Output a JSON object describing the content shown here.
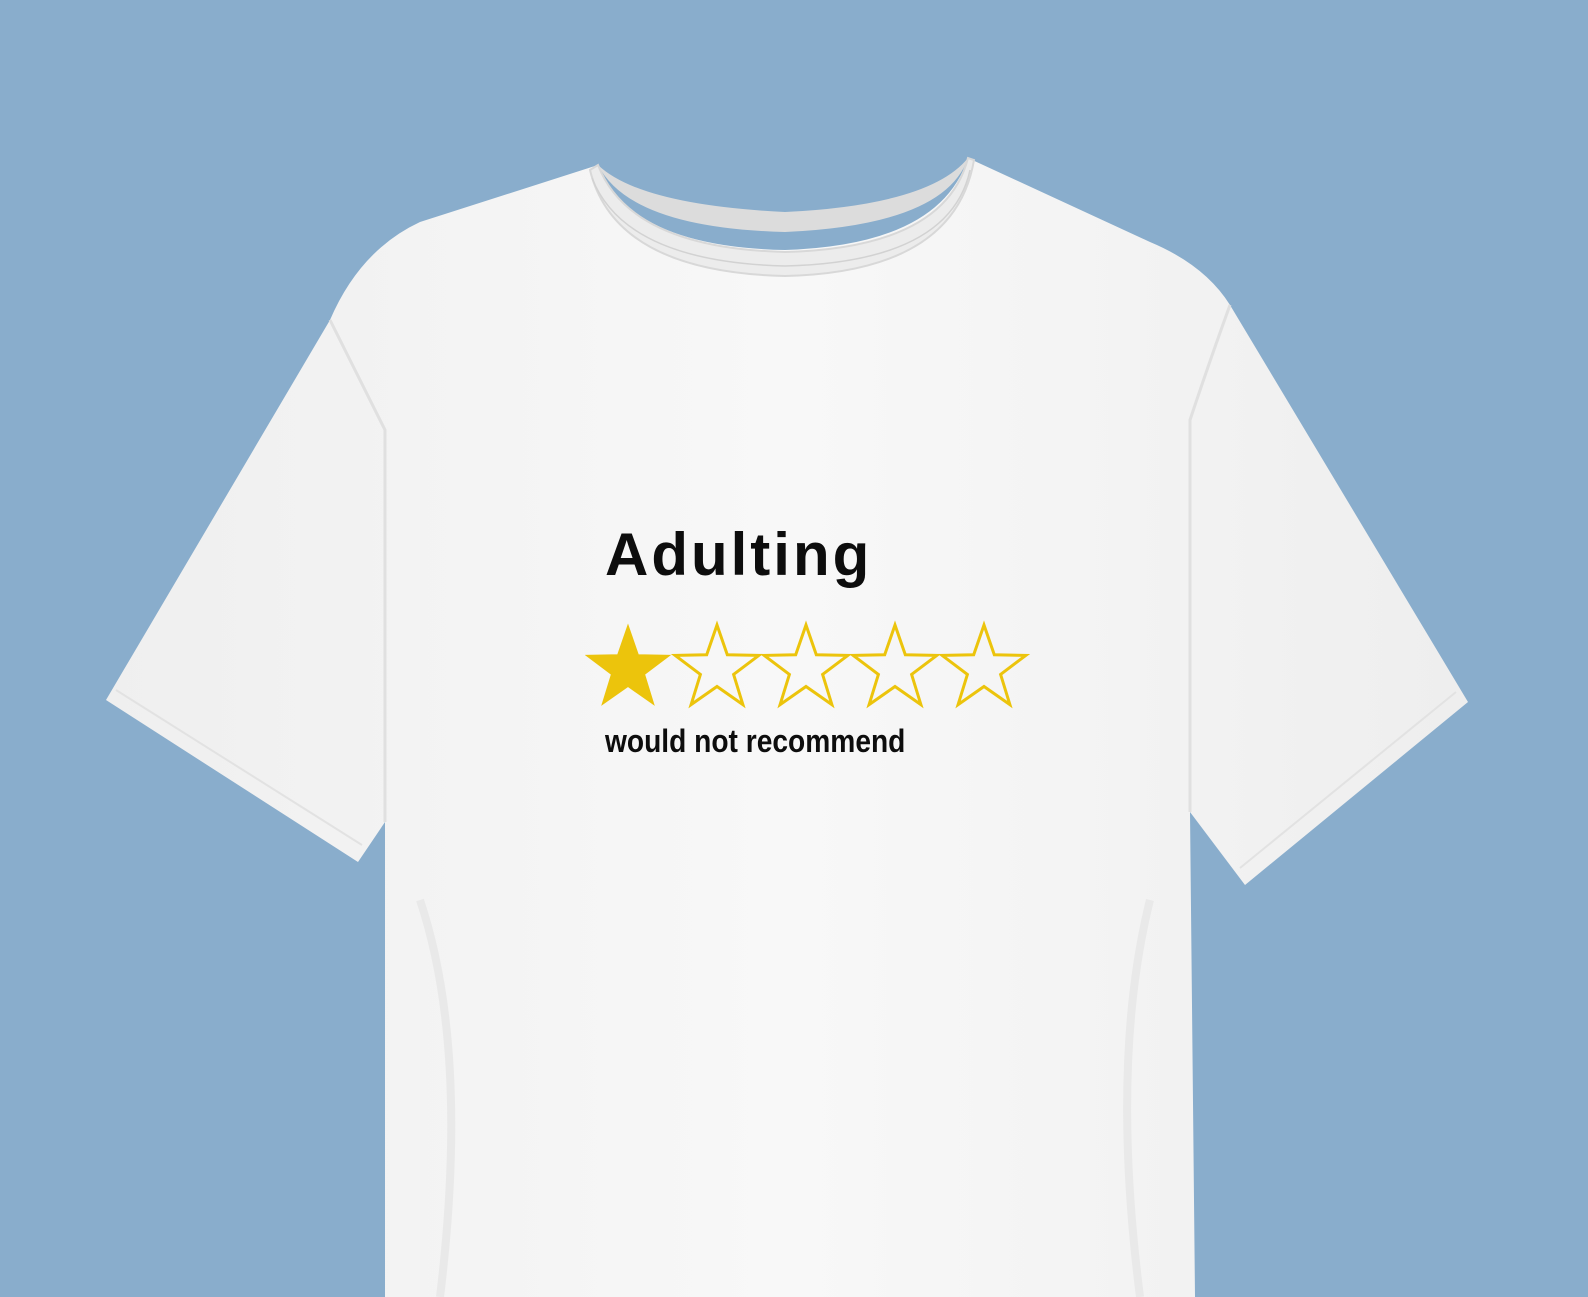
{
  "colors": {
    "background": "#89adcc",
    "shirt": "#f6f6f6",
    "shirt_shadow": "#e6e6e6",
    "star": "#ecc40c",
    "text": "#0d0d0d"
  },
  "print": {
    "title": "Adulting",
    "caption": "would not recommend",
    "rating": {
      "filled": 1,
      "total": 5
    }
  }
}
